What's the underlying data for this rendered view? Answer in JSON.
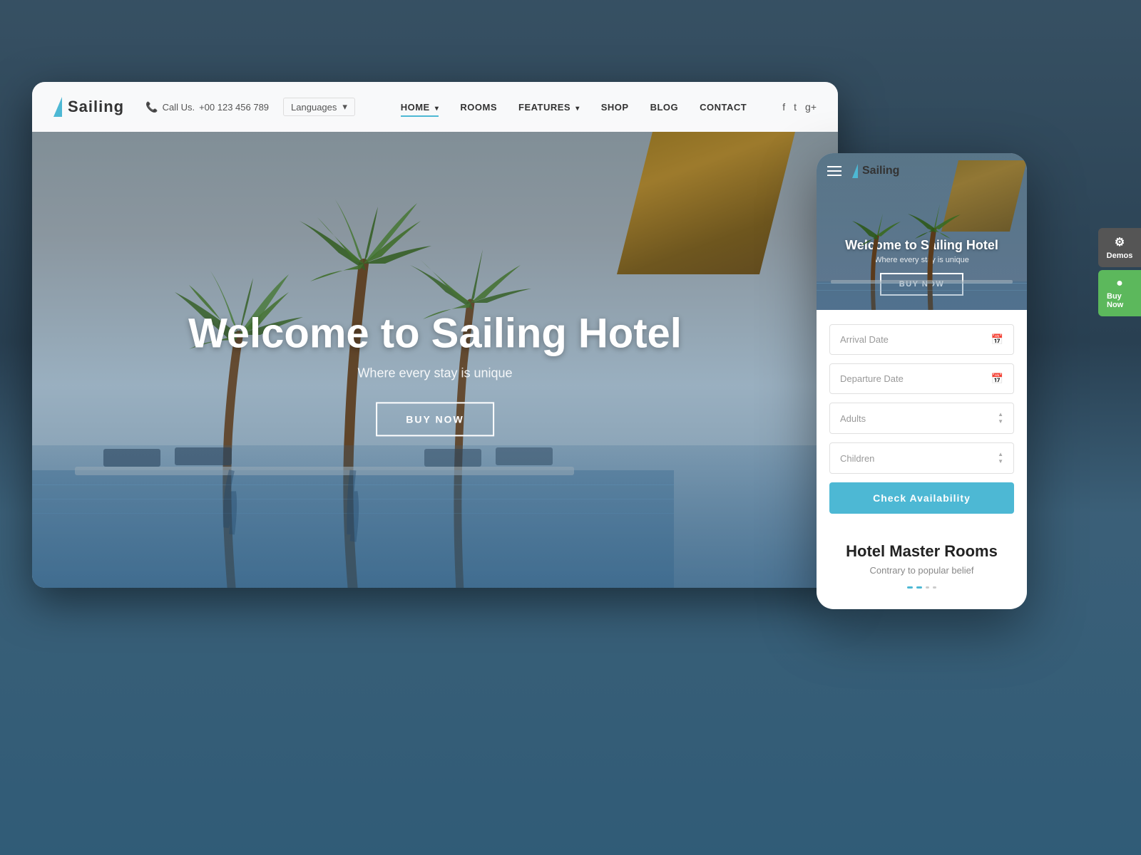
{
  "page": {
    "title": "Sailing Hotel - UI Preview"
  },
  "background": {
    "color": "#2a3a4a"
  },
  "desktop": {
    "navbar": {
      "logo_text": "Sailing",
      "phone_label": "Call Us.",
      "phone_number": "+00 123 456 789",
      "languages_label": "Languages",
      "menu_items": [
        {
          "label": "HOME",
          "active": true,
          "has_arrow": true
        },
        {
          "label": "ROOMS",
          "active": false,
          "has_arrow": false
        },
        {
          "label": "FEATURES",
          "active": false,
          "has_arrow": true
        },
        {
          "label": "SHOP",
          "active": false,
          "has_arrow": false
        },
        {
          "label": "BLOG",
          "active": false,
          "has_arrow": false
        },
        {
          "label": "CONTACT",
          "active": false,
          "has_arrow": false
        }
      ],
      "social": [
        "f",
        "t",
        "g+"
      ]
    },
    "hero": {
      "title": "Welcome to Sailing Hotel",
      "subtitle": "Where every stay is unique",
      "button_label": "BUY NOW"
    }
  },
  "mobile": {
    "navbar": {
      "logo_text": "Sailing"
    },
    "hero": {
      "title": "Welcome to Sailing Hotel",
      "subtitle": "Where every stay is unique",
      "button_label": "BUY NOW"
    },
    "booking_form": {
      "arrival_placeholder": "Arrival Date",
      "departure_placeholder": "Departure Date",
      "adults_placeholder": "Adults",
      "children_placeholder": "Children",
      "check_button": "Check Availability"
    },
    "rooms_section": {
      "title": "Hotel Master Rooms",
      "subtitle": "Contrary to popular belief"
    }
  },
  "side_panel": {
    "demos_label": "Demos",
    "buynow_label": "Buy Now",
    "demos_icon": "⚙",
    "buynow_icon": "●"
  }
}
